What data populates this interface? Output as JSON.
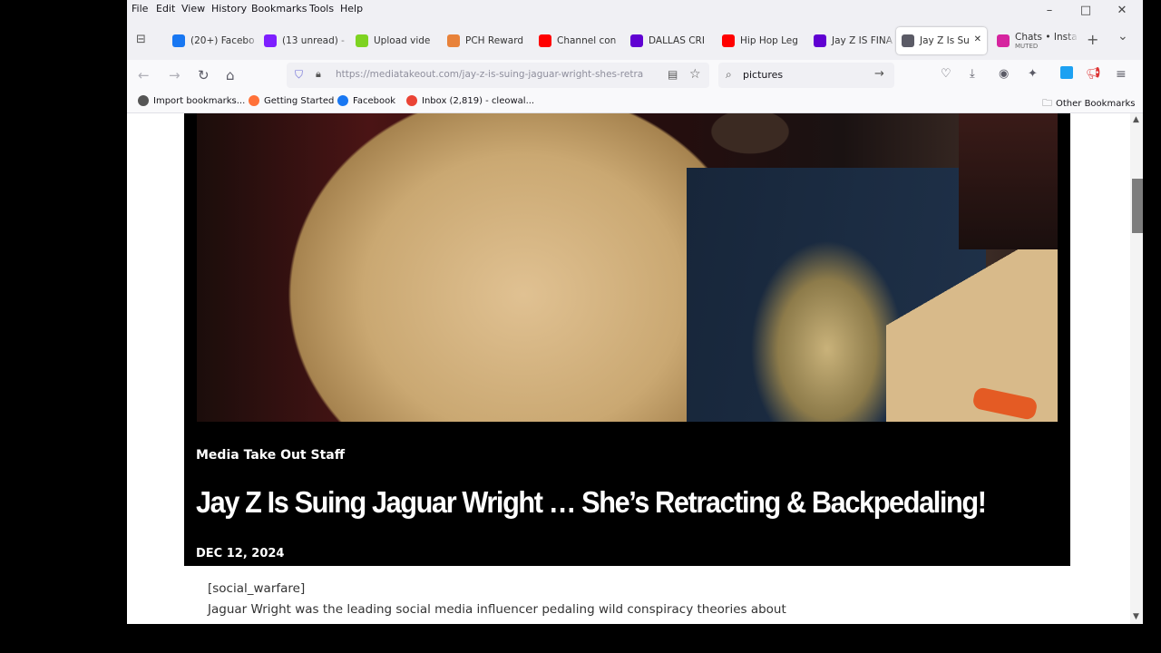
{
  "menubar": {
    "items": [
      "File",
      "Edit",
      "View",
      "History",
      "Bookmarks",
      "Tools",
      "Help"
    ],
    "minimize": "–",
    "maximize": "□",
    "close": "✕"
  },
  "tabs": [
    {
      "label": "(20+) Facebo",
      "icon": "facebook-icon",
      "color": "#1877f2"
    },
    {
      "label": "(13 unread) -",
      "icon": "mail-icon",
      "color": "#7e1fff"
    },
    {
      "label": "Upload vide",
      "icon": "upload-icon",
      "color": "#7ed321"
    },
    {
      "label": "PCH Reward",
      "icon": "pch-icon",
      "color": "#e8823a"
    },
    {
      "label": "Channel con",
      "icon": "youtube-icon",
      "color": "#ff0000"
    },
    {
      "label": "DALLAS CRI",
      "icon": "yahoo-icon",
      "color": "#6001d2"
    },
    {
      "label": "Hip Hop Leg",
      "icon": "youtube-icon",
      "color": "#ff0000"
    },
    {
      "label": "Jay Z IS FINA",
      "icon": "yahoo-icon",
      "color": "#6001d2"
    },
    {
      "label": "Jay Z Is Su",
      "icon": "page-icon",
      "color": "#5b5b66",
      "active": true
    },
    {
      "label": "Chats • Insta",
      "sub": "MUTED",
      "icon": "instagram-icon",
      "color": "#d6249f"
    }
  ],
  "tab_close": "✕",
  "new_tab": "+",
  "tab_list": "⌄",
  "nav": {
    "url": "https://mediatakeout.com/jay-z-is-suing-jaguar-wright-shes-retra",
    "search": "pictures"
  },
  "bookmarks": [
    {
      "label": "Import bookmarks...",
      "icon": "import-icon",
      "color": "#555"
    },
    {
      "label": "Getting Started",
      "icon": "firefox-icon",
      "color": "#ff7139"
    },
    {
      "label": "Facebook",
      "icon": "facebook-icon",
      "color": "#1877f2"
    },
    {
      "label": "Inbox (2,819) - cleowal...",
      "icon": "gmail-icon",
      "color": "#ea4335"
    }
  ],
  "other_bookmarks": "Other Bookmarks",
  "article": {
    "author": "Media Take Out Staff",
    "headline": "Jay Z Is Suing Jaguar Wright … She’s Retracting & Backpedaling!",
    "date": "DEC 12, 2024",
    "shortcode": "[social_warfare]",
    "body_line": "Jaguar Wright was the leading social media influencer pedaling wild conspiracy theories about"
  }
}
